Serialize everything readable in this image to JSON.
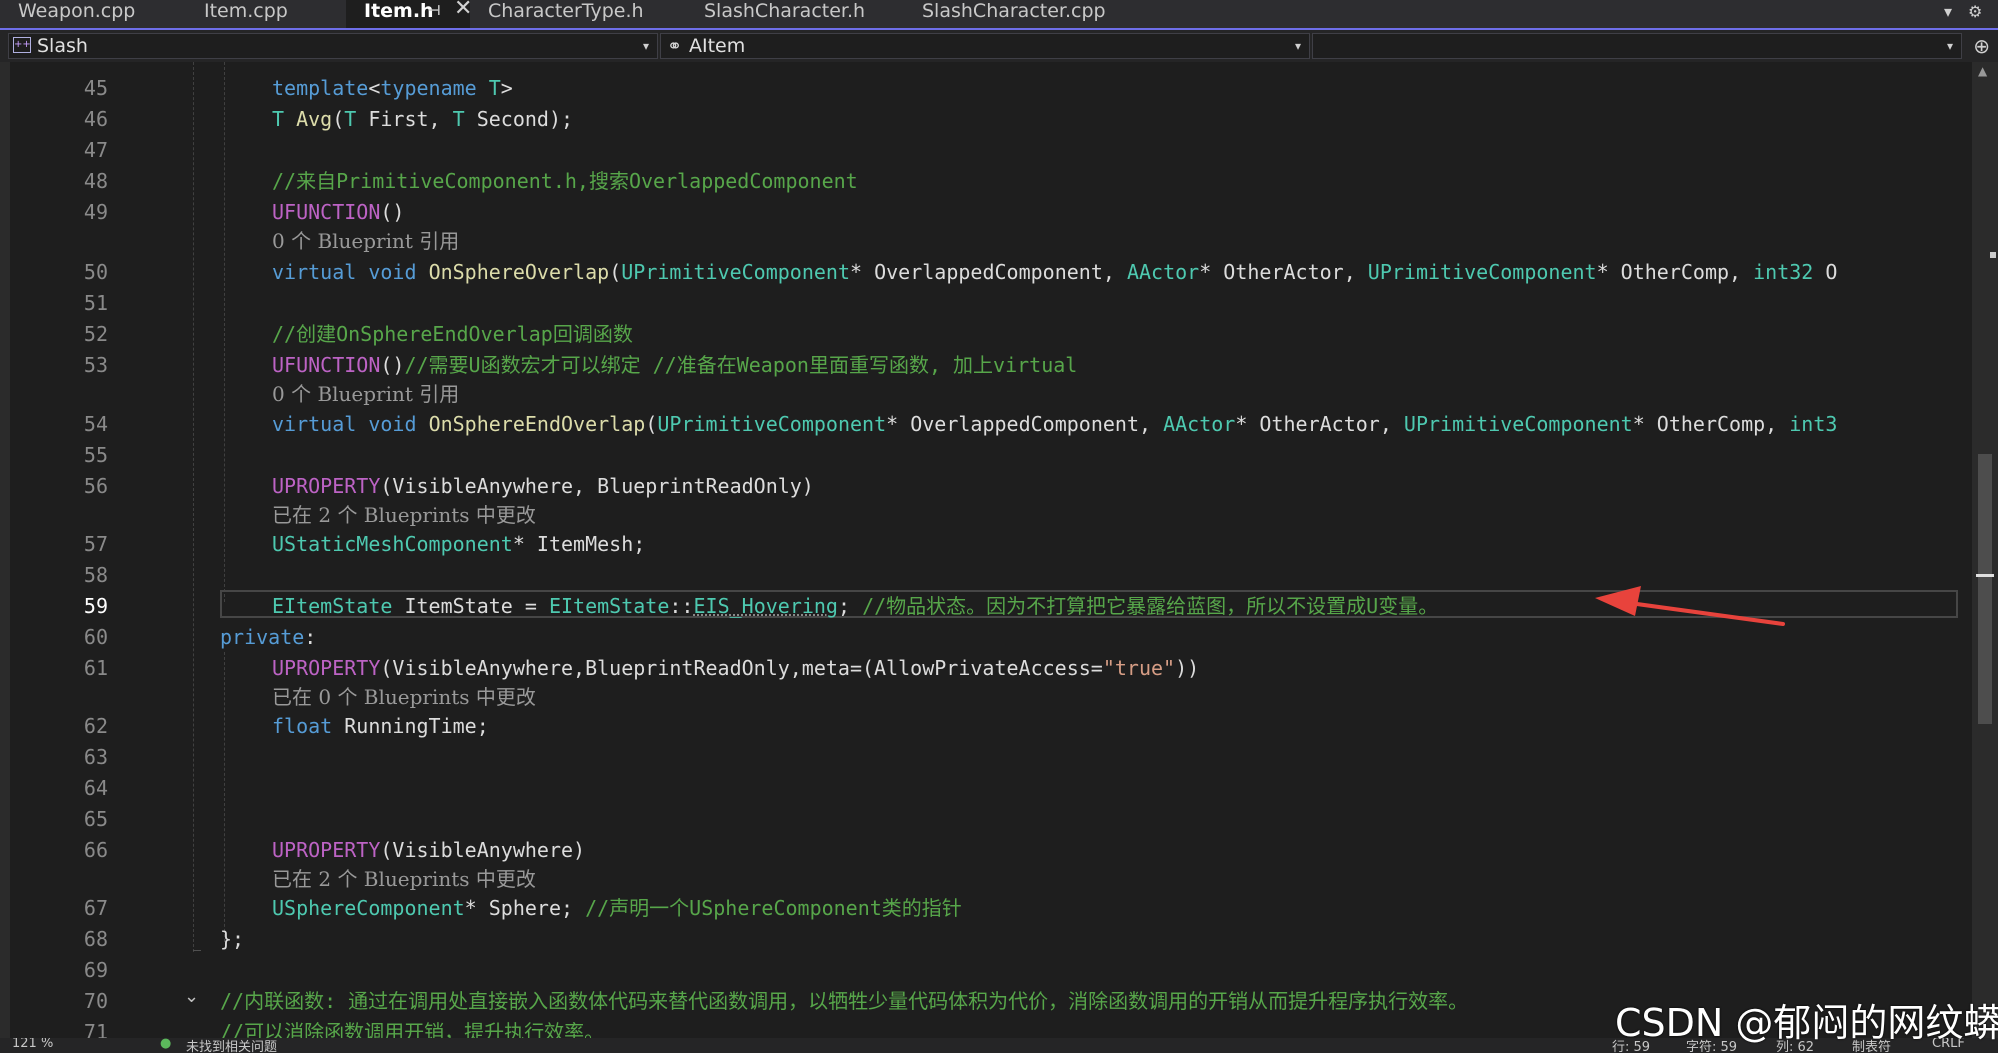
{
  "tabs": [
    {
      "label": "Weapon.cpp"
    },
    {
      "label": "Item.cpp"
    },
    {
      "label": "Item.h"
    },
    {
      "label": "CharacterType.h"
    },
    {
      "label": "SlashCharacter.h"
    },
    {
      "label": "SlashCharacter.cpp"
    }
  ],
  "icons": {
    "pin": "⊣",
    "close": "✕",
    "dropdown": "▾",
    "gear": "⚙"
  },
  "nav": {
    "project": "Slash",
    "class_scope": "AItem"
  },
  "lines": [
    {
      "n": "45"
    },
    {
      "n": "46"
    },
    {
      "n": "47"
    },
    {
      "n": "48"
    },
    {
      "n": "49"
    },
    {
      "n": "50"
    },
    {
      "n": "51"
    },
    {
      "n": "52"
    },
    {
      "n": "53"
    },
    {
      "n": "54"
    },
    {
      "n": "55"
    },
    {
      "n": "56"
    },
    {
      "n": "57"
    },
    {
      "n": "58"
    },
    {
      "n": "59"
    },
    {
      "n": "60"
    },
    {
      "n": "61"
    },
    {
      "n": "62"
    },
    {
      "n": "63"
    },
    {
      "n": "64"
    },
    {
      "n": "65"
    },
    {
      "n": "66"
    },
    {
      "n": "67"
    },
    {
      "n": "68"
    },
    {
      "n": "69"
    },
    {
      "n": "70"
    },
    {
      "n": "71"
    }
  ],
  "code": {
    "l45": {
      "a": "template",
      "b": "<",
      "c": "typename",
      "d": " T",
      "e": ">"
    },
    "l46": {
      "a": "T",
      "b": " Avg",
      "c": "(",
      "d": "T",
      "e": " First, ",
      "f": "T",
      "g": " Second);"
    },
    "l48": "//来自PrimitiveComponent.h,搜索OverlappedComponent",
    "l49": {
      "a": "UFUNCTION",
      "b": "()"
    },
    "lens49": "0 个 Blueprint 引用",
    "l50": {
      "a": "virtual",
      "b": " ",
      "c": "void",
      "d": " ",
      "e": "OnSphereOverlap",
      "f": "(",
      "g": "UPrimitiveComponent",
      "h": "* OverlappedComponent, ",
      "i": "AActor",
      "j": "* OtherActor, ",
      "k": "UPrimitiveComponent",
      "l": "* OtherComp, ",
      "m": "int32",
      "n": " O"
    },
    "l52": "//创建OnSphereEndOverlap回调函数",
    "l53": {
      "a": "UFUNCTION",
      "b": "()",
      "c": "//需要U函数宏才可以绑定 //准备在Weapon里面重写函数, 加上virtual"
    },
    "lens53": "0 个 Blueprint 引用",
    "l54": {
      "a": "virtual",
      "b": " ",
      "c": "void",
      "d": " ",
      "e": "OnSphereEndOverlap",
      "f": "(",
      "g": "UPrimitiveComponent",
      "h": "* OverlappedComponent, ",
      "i": "AActor",
      "j": "* OtherActor, ",
      "k": "UPrimitiveComponent",
      "l": "* OtherComp, ",
      "m": "int3"
    },
    "l56": {
      "a": "UPROPERTY",
      "b": "(VisibleAnywhere, BlueprintReadOnly)"
    },
    "lens56": "已在 2 个 Blueprints 中更改",
    "l57": {
      "a": "UStaticMeshComponent",
      "b": "* ItemMesh;"
    },
    "l59": {
      "a": "EItemState",
      "b": " ItemState = ",
      "c": "EItemState",
      "d": "::",
      "e": "EIS_Hovering",
      "f": ";",
      "g": " //物品状态。因为不打算把它暴露给蓝图，所以不设置成U变量。"
    },
    "l60": {
      "a": "private",
      "b": ":"
    },
    "l61": {
      "a": "UPROPERTY",
      "b": "(VisibleAnywhere,BlueprintReadOnly,meta=(AllowPrivateAccess=",
      "c": "\"true\"",
      "d": "))"
    },
    "lens61": "已在 0 个 Blueprints 中更改",
    "l62": {
      "a": "float",
      "b": " RunningTime;"
    },
    "l66": {
      "a": "UPROPERTY",
      "b": "(VisibleAnywhere)"
    },
    "lens66": "已在 2 个 Blueprints 中更改",
    "l67": {
      "a": "USphereComponent",
      "b": "* Sphere;",
      "c": " //声明一个USphereComponent类的指针"
    },
    "l68": "};",
    "l70": "//内联函数: 通过在调用处直接嵌入函数体代码来替代函数调用，以牺牲少量代码体积为代价，消除函数调用的开销从而提升程序执行效率。",
    "l71": "//可以消除函数调用开销，提升执行效率。"
  },
  "status": {
    "zoom": "121 %",
    "issues": "未找到相关问题",
    "line": "行: 59",
    "char": "字符: 59",
    "col": "列: 62",
    "tabs": "制表符",
    "eol": "CRLF"
  },
  "watermark": "CSDN @郁闷的网纹蟒",
  "colors": {
    "keyword": "#569cd6",
    "type": "#4ec9b0",
    "function": "#dcdcaa",
    "macro": "#bd63c5",
    "comment": "#57a64a",
    "string": "#d69d85",
    "arrow": "#e8433c",
    "tab_accent": "#6e6ee8"
  }
}
